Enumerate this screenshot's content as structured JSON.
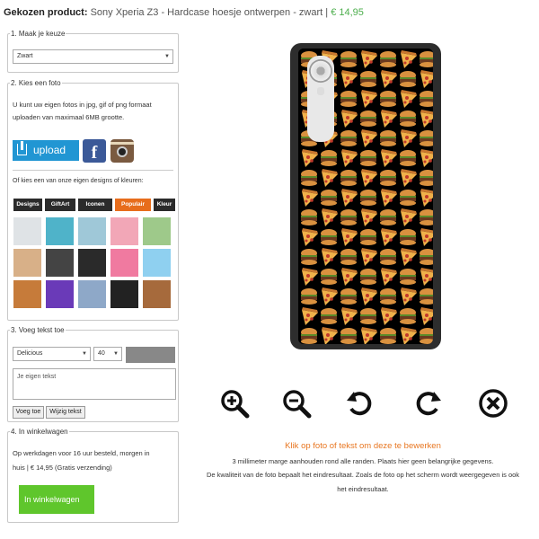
{
  "header": {
    "label": "Gekozen product:",
    "product": "Sony Xperia Z3 - Hardcase hoesje ontwerpen - zwart",
    "separator": "|",
    "price": "€ 14,95"
  },
  "step1": {
    "legend": "1. Maak je keuze",
    "select_value": "Zwart"
  },
  "step2": {
    "legend": "2. Kies een foto",
    "text_line1": "U kunt uw eigen fotos in jpg, gif of png formaat",
    "text_line2": "uploaden van maximaal 6MB grootte.",
    "upload_label": "upload",
    "facebook_glyph": "f",
    "designs_intro": "Of kies een van onze eigen designs of kleuren:",
    "tabs": [
      "Designs",
      "GiftArt",
      "Iconen",
      "Populair",
      "Kleur"
    ],
    "active_tab": "Populair",
    "thumbs": [
      {
        "name": "marble-thumb",
        "color": "#dfe3e6"
      },
      {
        "name": "feathers-thumb",
        "color": "#4fb3c9"
      },
      {
        "name": "crystal-thumb",
        "color": "#9fc8d8"
      },
      {
        "name": "flamingo-thumb",
        "color": "#f2a7b7"
      },
      {
        "name": "palm-thumb",
        "color": "#9ec98a"
      },
      {
        "name": "leopard-thumb",
        "color": "#d8b088"
      },
      {
        "name": "chevron-thumb",
        "color": "#444444"
      },
      {
        "name": "black-marble-thumb",
        "color": "#2a2a2a"
      },
      {
        "name": "hearts-thumb",
        "color": "#f07aa0"
      },
      {
        "name": "balloon-thumb",
        "color": "#8fd0f0"
      },
      {
        "name": "pizza-thumb",
        "color": "#c67b3a"
      },
      {
        "name": "rainbow-drip-thumb",
        "color": "#6a3ab8"
      },
      {
        "name": "zigzag-thumb",
        "color": "#8ea8c8"
      },
      {
        "name": "stripes-thumb",
        "color": "#222222"
      },
      {
        "name": "coffee-beans-thumb",
        "color": "#a66a3c"
      }
    ]
  },
  "step3": {
    "legend": "3. Voeg tekst toe",
    "font_value": "Delicious",
    "size_value": "40",
    "color_swatch": "#888888",
    "text_value": "Je eigen tekst",
    "add_button": "Voeg toe",
    "edit_button": "Wijzig tekst"
  },
  "step4": {
    "legend": "4. In winkelwagen",
    "text_line1": "Op werkdagen voor 16 uur besteld, morgen in",
    "text_line2": "huis | € 14,95 (Gratis verzending)",
    "buy_label": "In winkelwagen"
  },
  "tools": [
    {
      "name": "zoom-in-icon"
    },
    {
      "name": "zoom-out-icon"
    },
    {
      "name": "rotate-left-icon"
    },
    {
      "name": "rotate-right-icon"
    },
    {
      "name": "delete-icon"
    }
  ],
  "notes": {
    "title": "Klik op foto of tekst om deze te bewerken",
    "line1": "3 millimeter marge aanhouden rond alle randen. Plaats hier geen belangrijke gegevens.",
    "line2": "De kwaliteit van de foto bepaalt het eindresultaat. Zoals de foto op het scherm wordt weergegeven is ook",
    "line3": "het eindresultaat."
  },
  "colors": {
    "accent_orange": "#e76d1c",
    "price_green": "#4cae4c",
    "buy_green": "#5fc62c",
    "upload_blue": "#2196d3",
    "phone_case": "#2d2d2d"
  }
}
